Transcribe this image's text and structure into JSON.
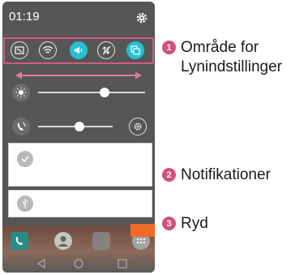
{
  "status_bar": {
    "time": "01:19"
  },
  "quick_settings": {
    "toggles": [
      {
        "icon": "capture-plus-icon",
        "active": false
      },
      {
        "icon": "wifi-icon",
        "active": false
      },
      {
        "icon": "sound-icon",
        "active": true
      },
      {
        "icon": "data-off-icon",
        "active": false
      },
      {
        "icon": "copy-icon",
        "active": true
      }
    ]
  },
  "sliders": {
    "brightness": {
      "icon": "brightness-icon",
      "level": 0.62
    },
    "volume": {
      "icon": "ringtone-icon",
      "level": 0.55
    }
  },
  "notifications": [
    {
      "icon": "check-icon"
    },
    {
      "icon": "usb-icon"
    }
  ],
  "callouts": [
    {
      "number": "1",
      "text_line1": "Område for",
      "text_line2": "Lynindstillinger"
    },
    {
      "number": "2",
      "text_line1": "Notifikationer"
    },
    {
      "number": "3",
      "text_line1": "Ryd"
    }
  ],
  "colors": {
    "accent": "#27c1cf",
    "callout_frame": "#d35a86",
    "badge": "#d5507b",
    "clear_button": "#f26a2a"
  }
}
